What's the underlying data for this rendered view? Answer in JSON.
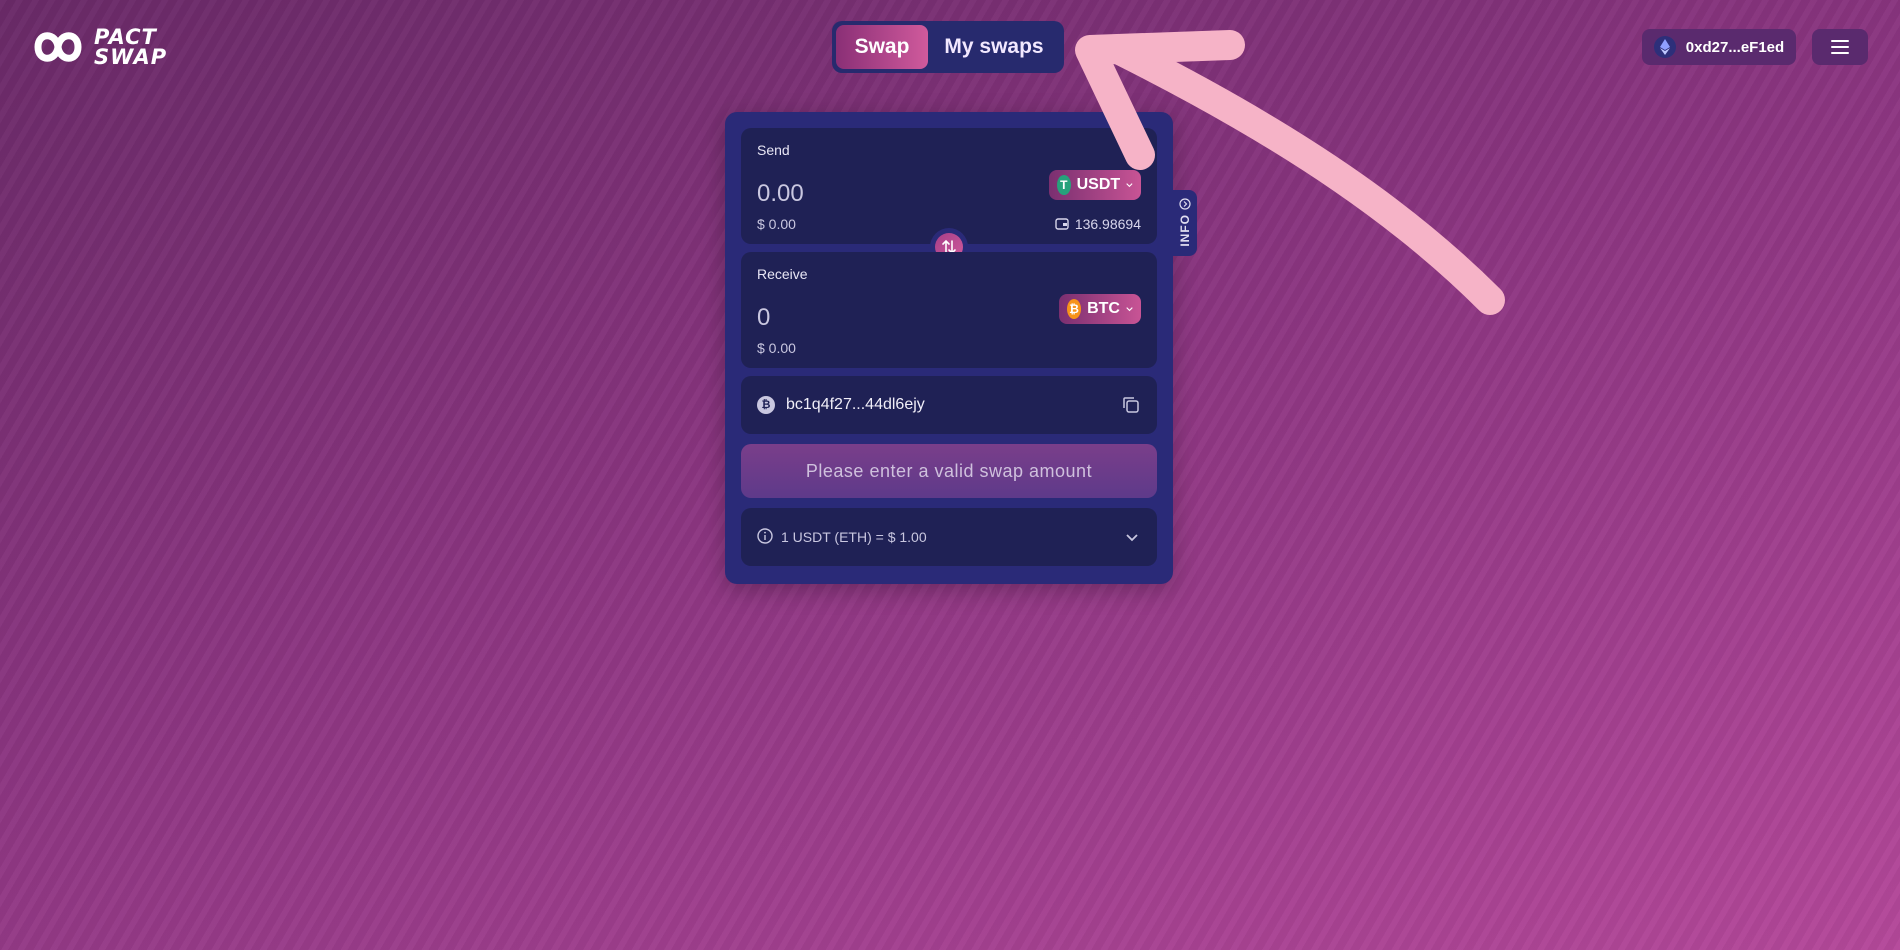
{
  "logo": {
    "line1": "PACT",
    "line2": "SWAP"
  },
  "tabs": [
    {
      "label": "Swap",
      "active": true
    },
    {
      "label": "My swaps",
      "active": false
    }
  ],
  "wallet": {
    "address": "0xd27...eF1ed",
    "icon": "ethereum-icon"
  },
  "send": {
    "label": "Send",
    "amount": "0.00",
    "usd": "$ 0.00",
    "token": "USDT",
    "balance": "136.98694"
  },
  "receive": {
    "label": "Receive",
    "amount": "0",
    "usd": "$ 0.00",
    "token": "BTC"
  },
  "address": {
    "value": "bc1q4f27...44dl6ejy"
  },
  "cta": {
    "label": "Please enter a valid swap amount"
  },
  "rate": {
    "text": "1 USDT (ETH) = $ 1.00"
  },
  "info_tab": {
    "label": "INFO"
  },
  "colors": {
    "accent": "#d05a9c",
    "card": "#2a2a78",
    "panel": "#1f2155",
    "annotation_arrow": "#f6b3c7",
    "usdt": "#26a17b",
    "btc": "#f7931a"
  }
}
